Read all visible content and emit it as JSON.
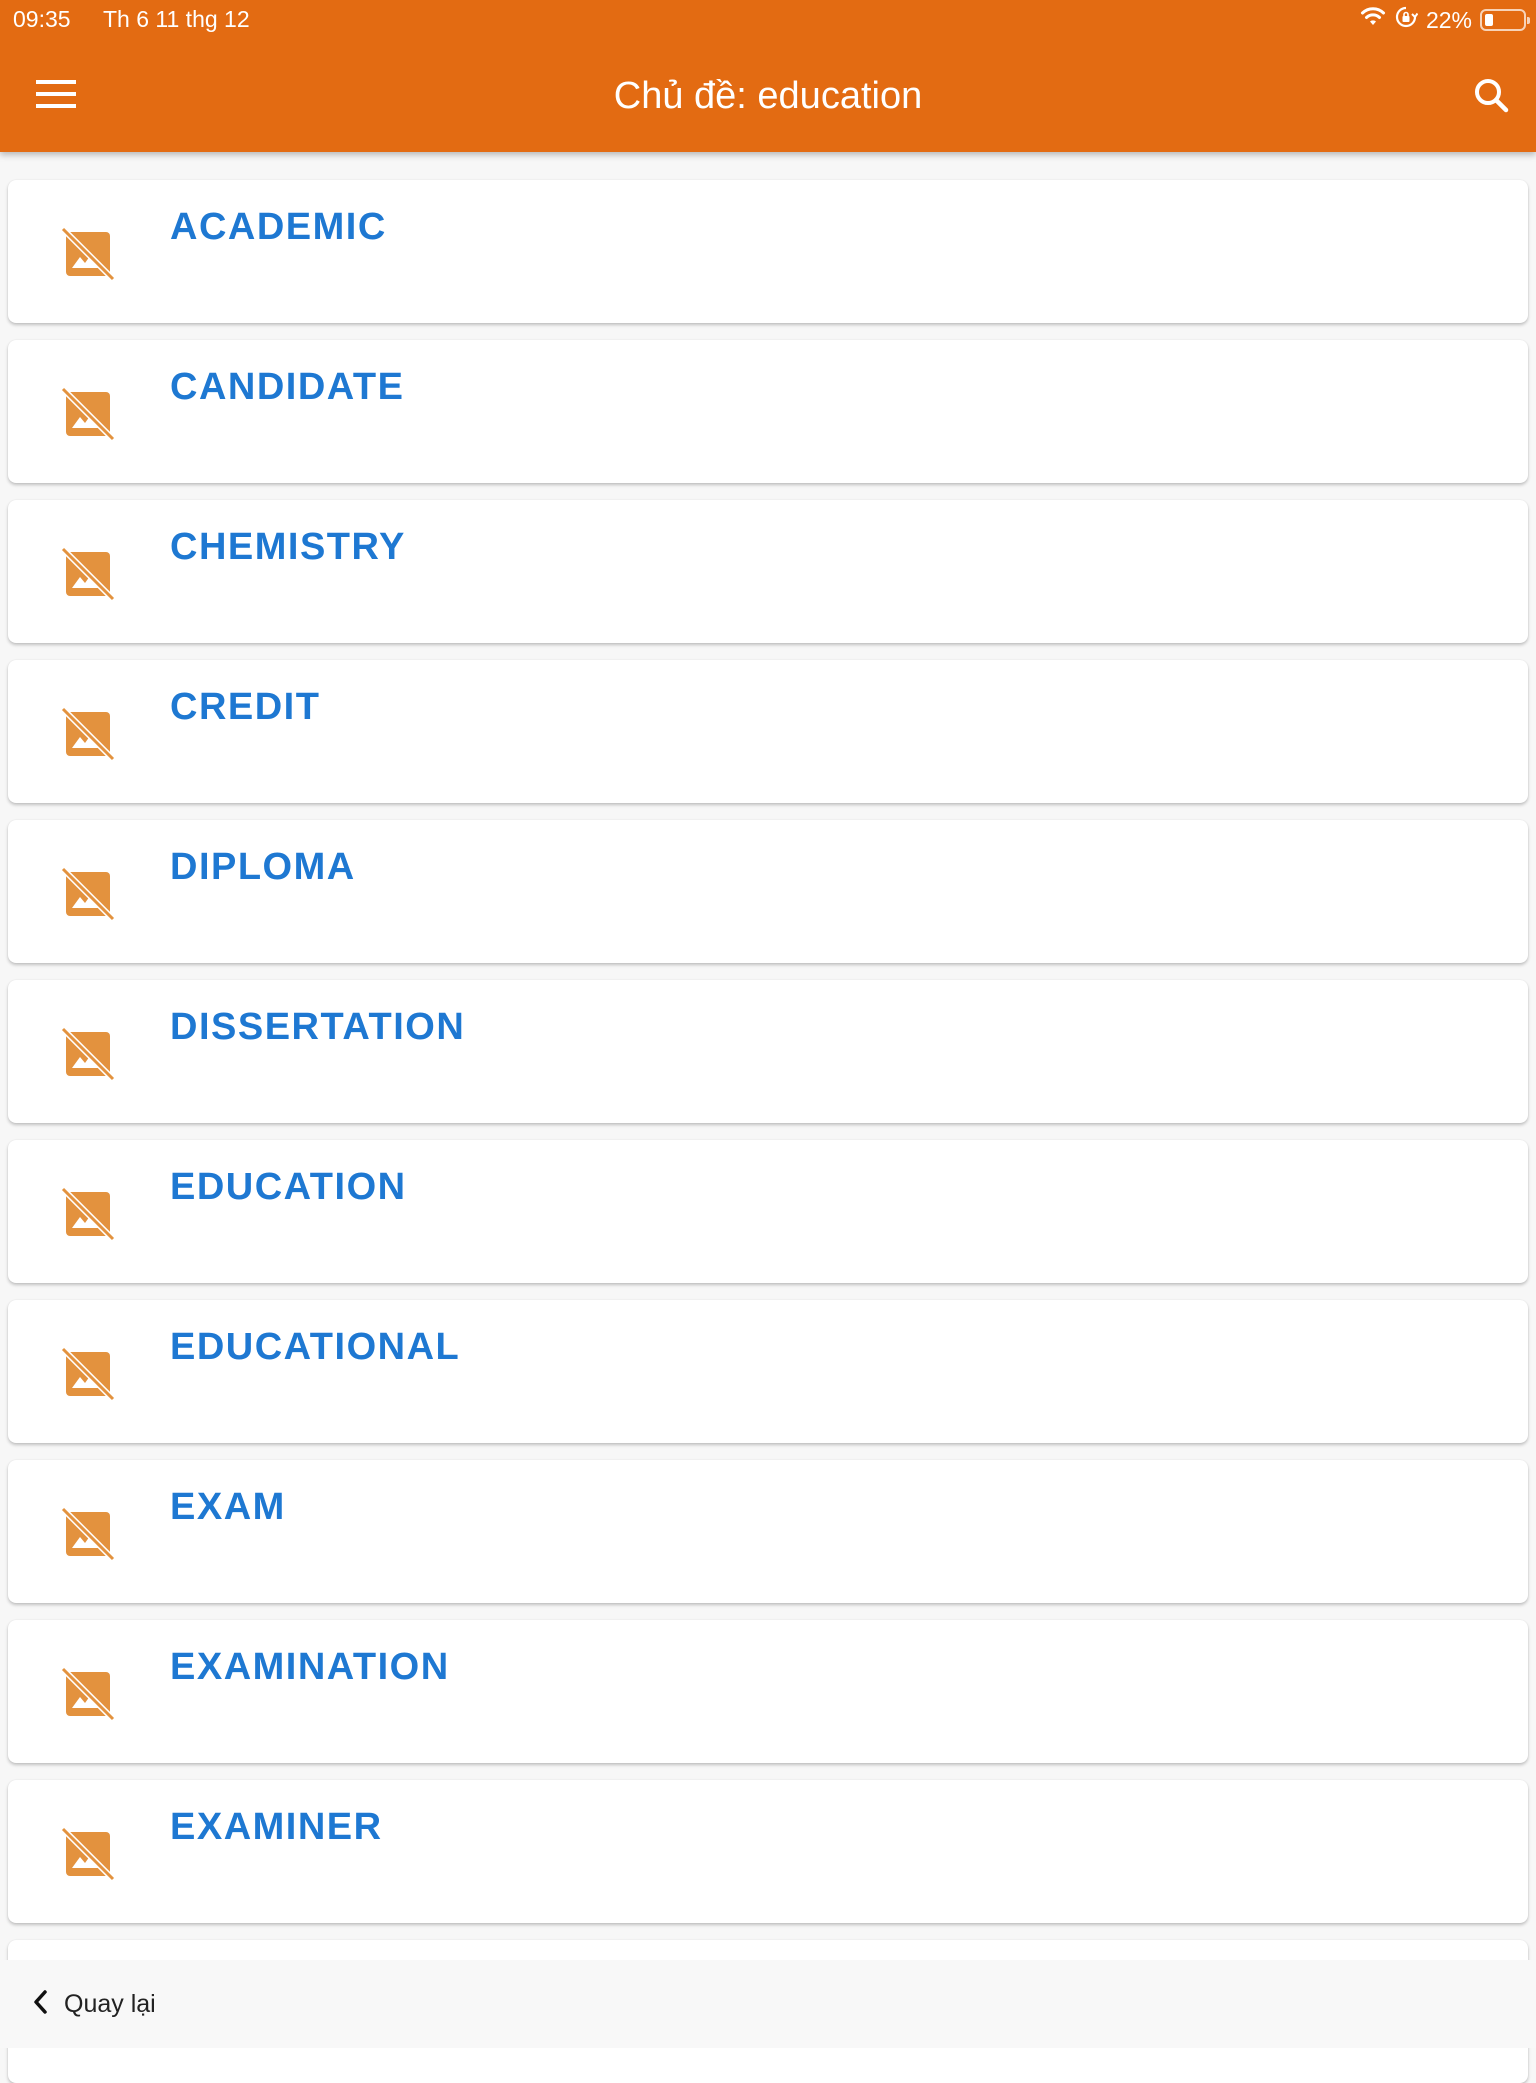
{
  "status_bar": {
    "time": "09:35",
    "date": "Th 6 11 thg 12",
    "battery_percent": "22%",
    "battery_level": 0.22,
    "icons": [
      "wifi-icon",
      "rotation-lock-icon",
      "battery-icon"
    ]
  },
  "app_bar": {
    "title": "Chủ đề: education",
    "menu_icon": "hamburger-menu-icon",
    "search_icon": "search-icon",
    "background_color": "#e36b12"
  },
  "list": {
    "item_icon": "image-not-supported-icon",
    "icon_color": "#e3923e",
    "text_color": "#1e78d2",
    "items": [
      {
        "word": "ACADEMIC"
      },
      {
        "word": "CANDIDATE"
      },
      {
        "word": "CHEMISTRY"
      },
      {
        "word": "CREDIT"
      },
      {
        "word": "DIPLOMA"
      },
      {
        "word": "DISSERTATION"
      },
      {
        "word": "EDUCATION"
      },
      {
        "word": "EDUCATIONAL"
      },
      {
        "word": "EXAM"
      },
      {
        "word": "EXAMINATION"
      },
      {
        "word": "EXAMINER"
      },
      {
        "word": ""
      }
    ]
  },
  "bottom_bar": {
    "back_label": "Quay lại",
    "back_icon": "chevron-left-icon"
  }
}
